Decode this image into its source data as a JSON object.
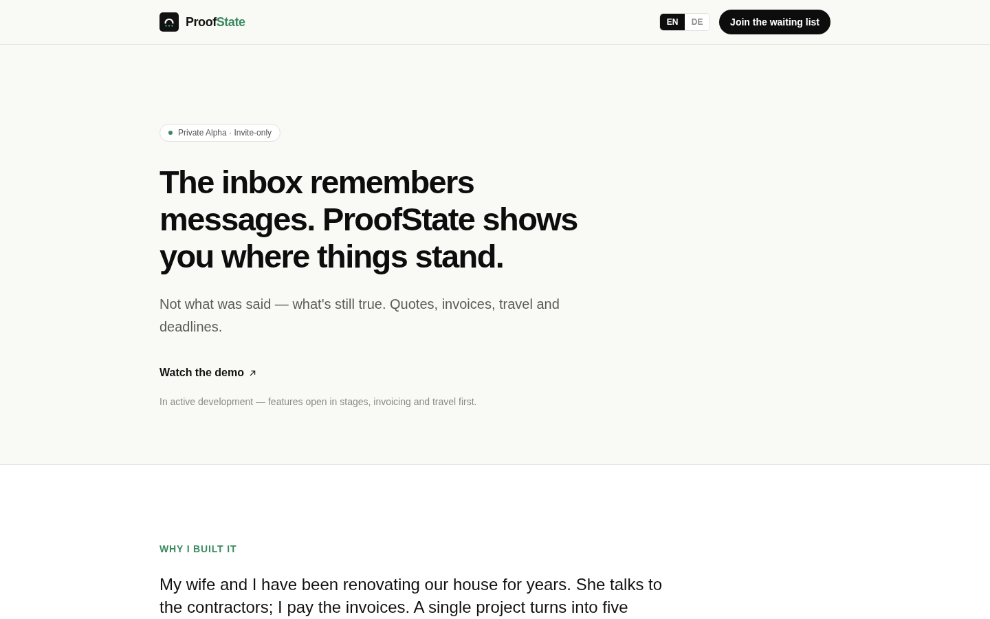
{
  "header": {
    "brand": {
      "first": "Proof",
      "second": "State"
    },
    "languages": [
      {
        "label": "EN",
        "selected": true
      },
      {
        "label": "DE",
        "selected": false
      }
    ],
    "cta": "Join the waiting list"
  },
  "hero": {
    "badge": "Private Alpha · Invite-only",
    "headline": "The inbox remembers messages. ProofState shows you where things stand.",
    "subtitle": "Not what was said — what's still true. Quotes, invoices, travel and deadlines.",
    "demo_link": "Watch the demo",
    "note": "In active development — features open in stages, invoicing and travel first."
  },
  "why": {
    "eyebrow": "WHY I BUILT IT",
    "text": "My wife and I have been renovating our house for years. She talks to the contractors; I pay the invoices. A single project turns into five"
  }
}
